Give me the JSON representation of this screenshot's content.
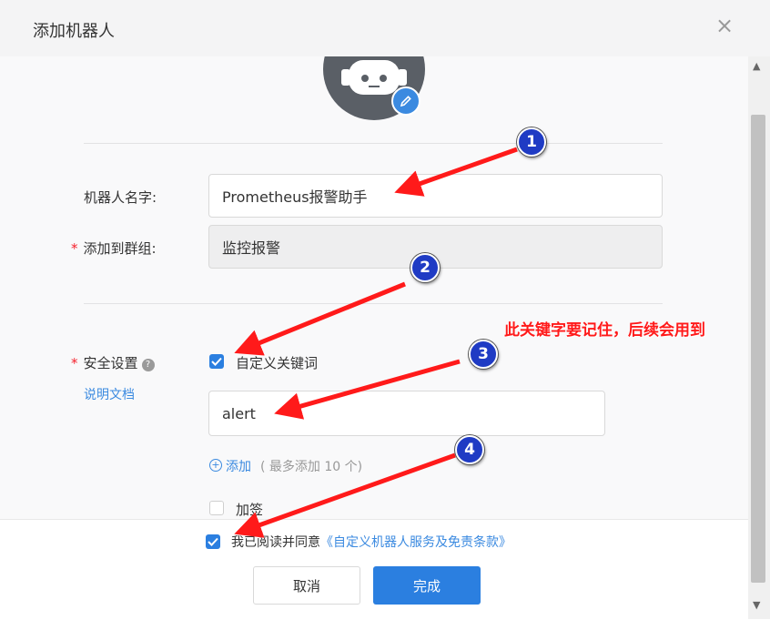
{
  "dialog": {
    "title": "添加机器人",
    "close_glyph": "×"
  },
  "form": {
    "name_label": "机器人名字:",
    "name_value": "Prometheus报警助手",
    "group_required_mark": "*",
    "group_label": "添加到群组:",
    "group_value": "监控报警",
    "security_required_mark": "*",
    "security_label": "安全设置",
    "help_glyph": "?",
    "doc_link": "说明文档",
    "keyword_checkbox_label": "自定义关键词",
    "keyword_checked": true,
    "keyword_value": "alert",
    "add_link": "添加",
    "add_hint": "( 最多添加 10 个)",
    "sign_label": "加签",
    "sign_checked": false
  },
  "footer": {
    "agree_checked": true,
    "agree_text": "我已阅读并同意",
    "agree_link": "《自定义机器人服务及免责条款》",
    "cancel_label": "取消",
    "ok_label": "完成"
  },
  "annotations": {
    "markers": [
      "1",
      "2",
      "3",
      "4"
    ],
    "note": "此关键字要记住，后续会用到",
    "color": "#ff1a1a"
  },
  "icons": [
    "robot-avatar",
    "edit-pencil-icon",
    "help-icon",
    "plus-circle-icon",
    "checkbox-checked-icon"
  ],
  "colors": {
    "accent": "#2b7fe0",
    "required": "#f5222d",
    "marker": "#1f3bc4"
  }
}
